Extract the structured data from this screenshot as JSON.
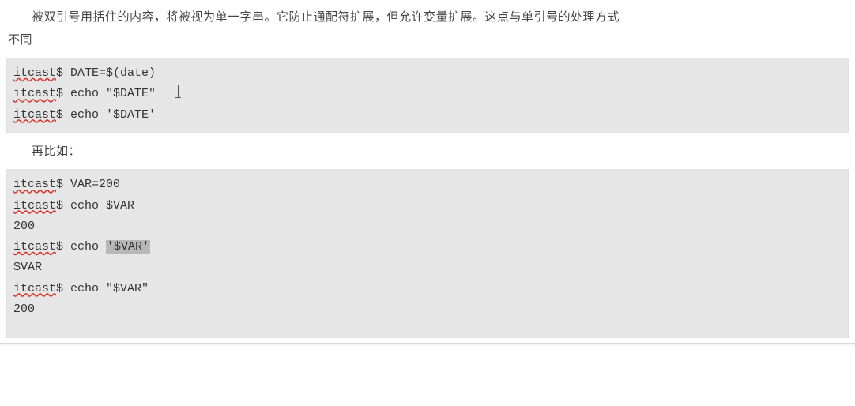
{
  "paragraphs": {
    "p1_line1": "被双引号用括住的内容，将被视为单一字串。它防止通配符扩展，但允许变量扩展。这点与单引号的处理方式",
    "p1_line2": "不同",
    "p2": "再比如："
  },
  "code1": {
    "prompt": "itcast",
    "line1_cmd": "$ DATE=$(date)",
    "line2_cmd": "$ echo \"$DATE\"",
    "line3_cmd": "$ echo '$DATE'"
  },
  "code2": {
    "prompt": "itcast",
    "line1_cmd": "$ VAR=200",
    "line2_cmd": "$ echo $VAR",
    "line3_out": "200",
    "line4_cmd_a": "$ echo ",
    "line4_cmd_highlight": "'$VAR'",
    "line5_out": "$VAR",
    "line6_cmd": "$ echo \"$VAR\"",
    "line7_out": "200"
  }
}
